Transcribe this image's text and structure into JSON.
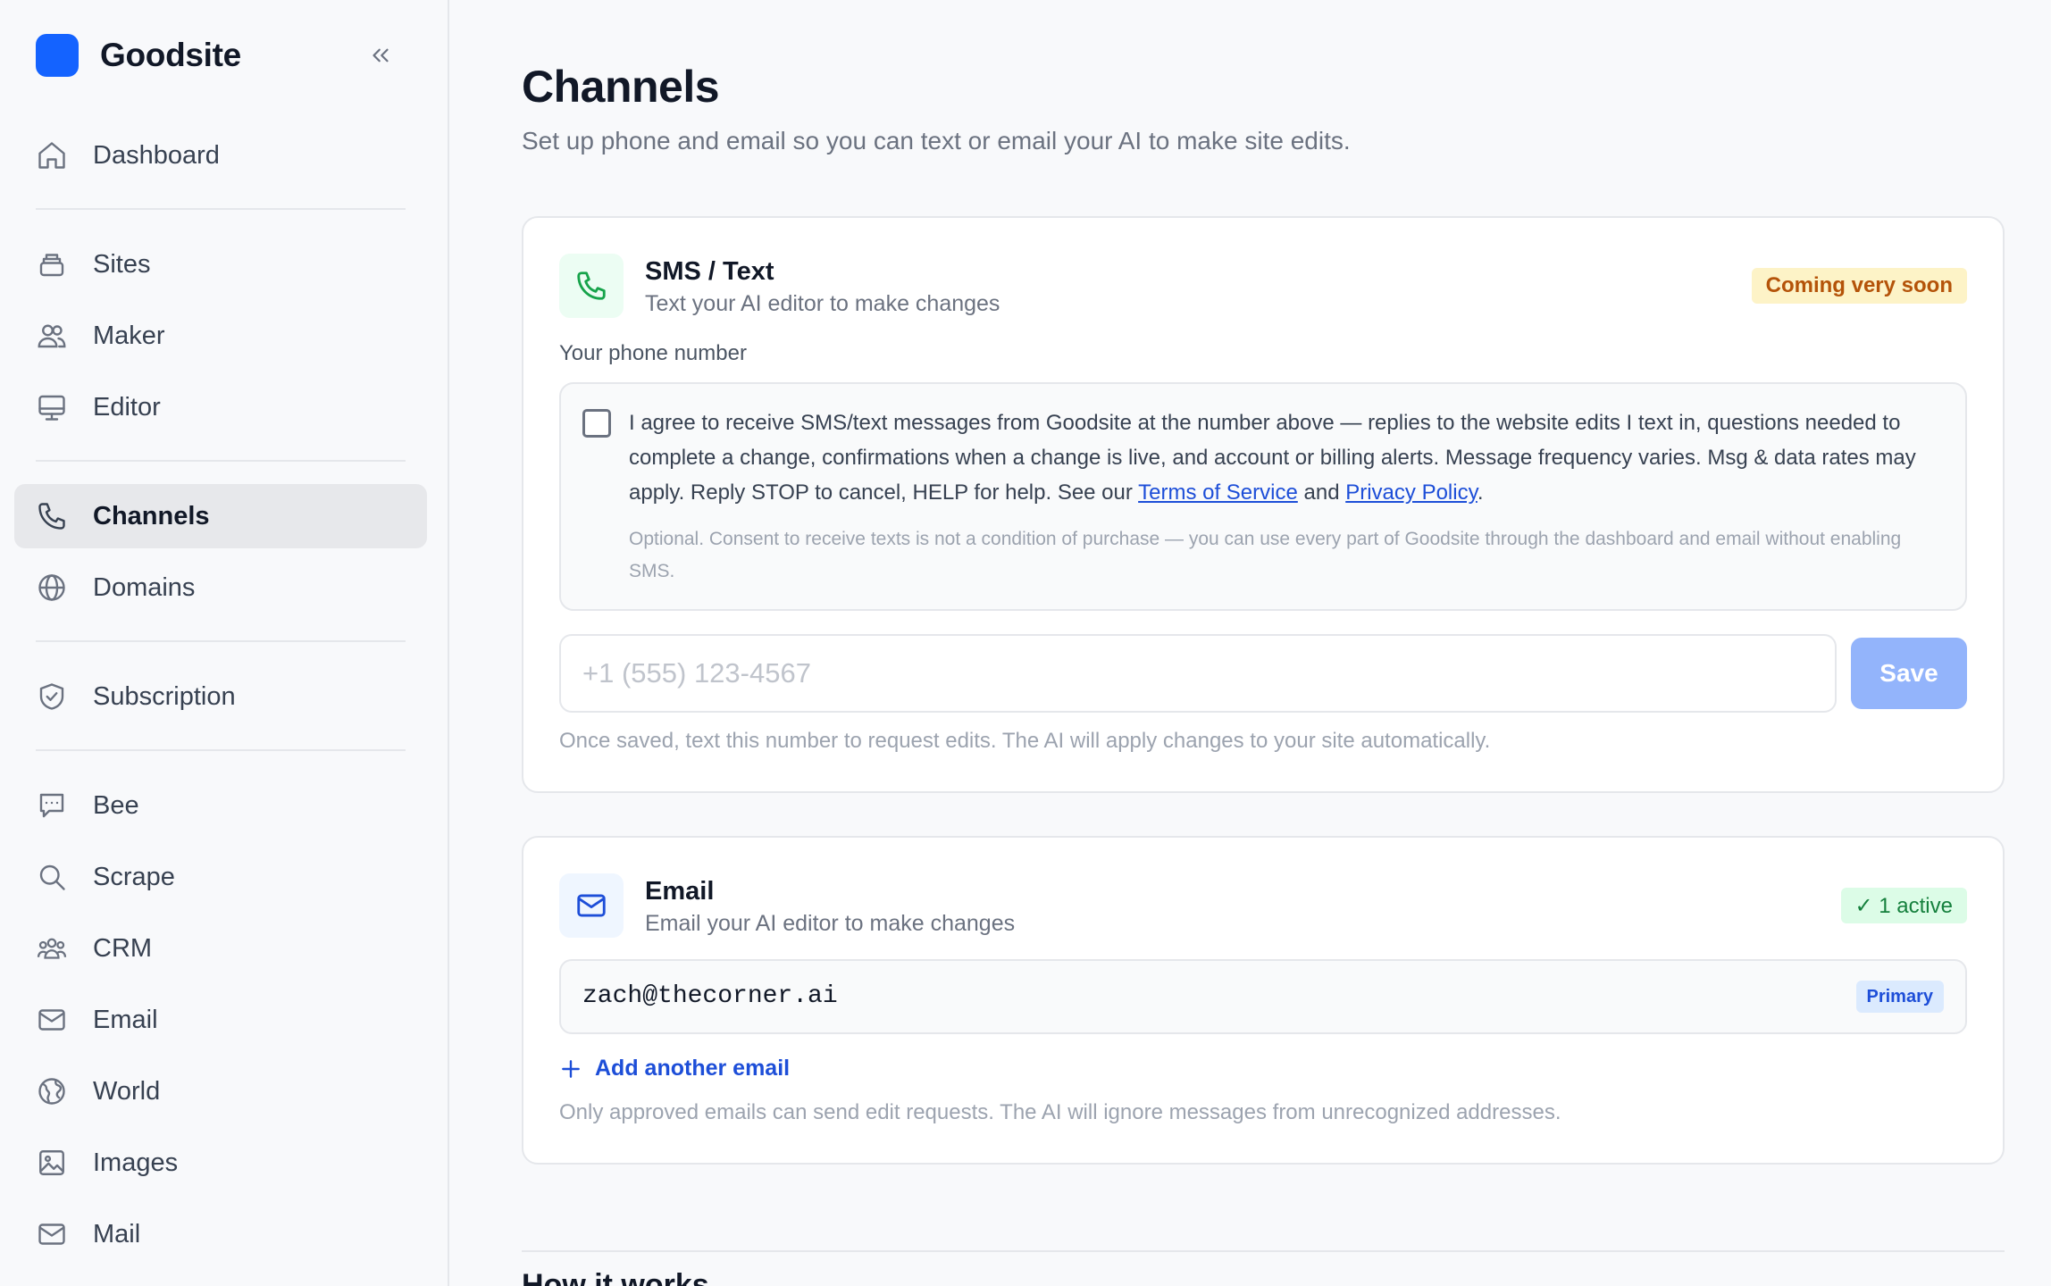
{
  "brand": {
    "name": "Goodsite",
    "logo_color": "#1463ff"
  },
  "sidebar": {
    "collapse_icon": "double-chevron-left-icon",
    "items": [
      {
        "label": "Dashboard",
        "icon": "home-icon",
        "active": false
      },
      {
        "label": "Sites",
        "icon": "layers-icon",
        "active": false
      },
      {
        "label": "Maker",
        "icon": "users-icon",
        "active": false
      },
      {
        "label": "Editor",
        "icon": "monitor-icon",
        "active": false
      },
      {
        "label": "Channels",
        "icon": "phone-icon",
        "active": true
      },
      {
        "label": "Domains",
        "icon": "globe-icon",
        "active": false
      },
      {
        "label": "Subscription",
        "icon": "shield-check-icon",
        "active": false
      },
      {
        "label": "Bee",
        "icon": "message-icon",
        "active": false
      },
      {
        "label": "Scrape",
        "icon": "search-icon",
        "active": false
      },
      {
        "label": "CRM",
        "icon": "group-icon",
        "active": false
      },
      {
        "label": "Email",
        "icon": "mail-icon",
        "active": false
      },
      {
        "label": "World",
        "icon": "world-icon",
        "active": false
      },
      {
        "label": "Images",
        "icon": "image-icon",
        "active": false
      },
      {
        "label": "Mail",
        "icon": "mail-icon",
        "active": false
      }
    ]
  },
  "page": {
    "title": "Channels",
    "subtitle": "Set up phone and email so you can text or email your AI to make site edits."
  },
  "sms": {
    "title": "SMS / Text",
    "description": "Text your AI editor to make changes",
    "badge": "Coming very soon",
    "field_label": "Your phone number",
    "consent_text_1": "I agree to receive SMS/text messages from Goodsite at the number above — replies to the website edits I text in, questions needed to complete a change, confirmations when a change is live, and account or billing alerts. Message frequency varies. Msg & data rates may apply. Reply STOP to cancel, HELP for help. See our ",
    "terms_link": "Terms of Service",
    "consent_and": " and ",
    "privacy_link": "Privacy Policy",
    "consent_end": ".",
    "consent_note": "Optional. Consent to receive texts is not a condition of purchase — you can use every part of Goodsite through the dashboard and email without enabling SMS.",
    "phone_placeholder": "+1 (555) 123-4567",
    "phone_value": "",
    "save_label": "Save",
    "hint": "Once saved, text this number to request edits. The AI will apply changes to your site automatically."
  },
  "email": {
    "title": "Email",
    "description": "Email your AI editor to make changes",
    "badge": "✓ 1 active",
    "address": "zach@thecorner.ai",
    "primary_label": "Primary",
    "add_label": "Add another email",
    "hint": "Only approved emails can send edit requests. The AI will ignore messages from unrecognized addresses."
  },
  "how_it_works": {
    "title": "How it works"
  },
  "colors": {
    "accent": "#1463ff",
    "link": "#1d4ed8",
    "soon_bg": "#fdf3c7",
    "soon_text": "#b45309",
    "active_bg": "#dcfce7",
    "active_text": "#15803d",
    "save_disabled": "#93b4fb"
  }
}
